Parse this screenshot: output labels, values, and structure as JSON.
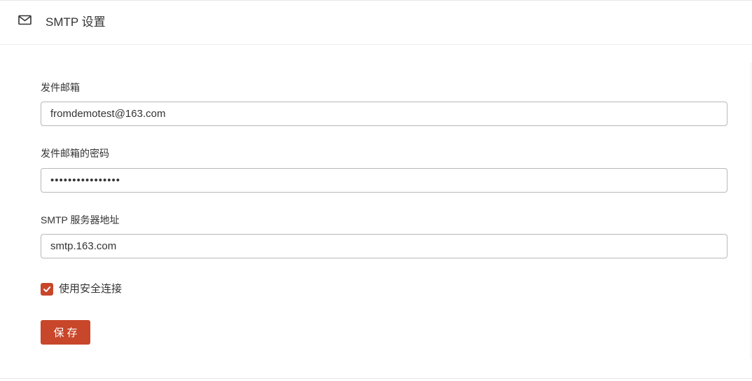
{
  "header": {
    "icon": "mail-icon",
    "title": "SMTP 设置"
  },
  "form": {
    "from_email": {
      "label": "发件邮箱",
      "value": "fromdemotest@163.com"
    },
    "password": {
      "label": "发件邮箱的密码",
      "value": "••••••••••••••••"
    },
    "smtp_server": {
      "label": "SMTP 服务器地址",
      "value": "smtp.163.com"
    },
    "secure_connection": {
      "label": "使用安全连接",
      "checked": true,
      "icon": "check-icon"
    },
    "save_label": "保存"
  },
  "colors": {
    "accent": "#c8462a",
    "border": "#b8b8b8",
    "text": "#333333"
  }
}
